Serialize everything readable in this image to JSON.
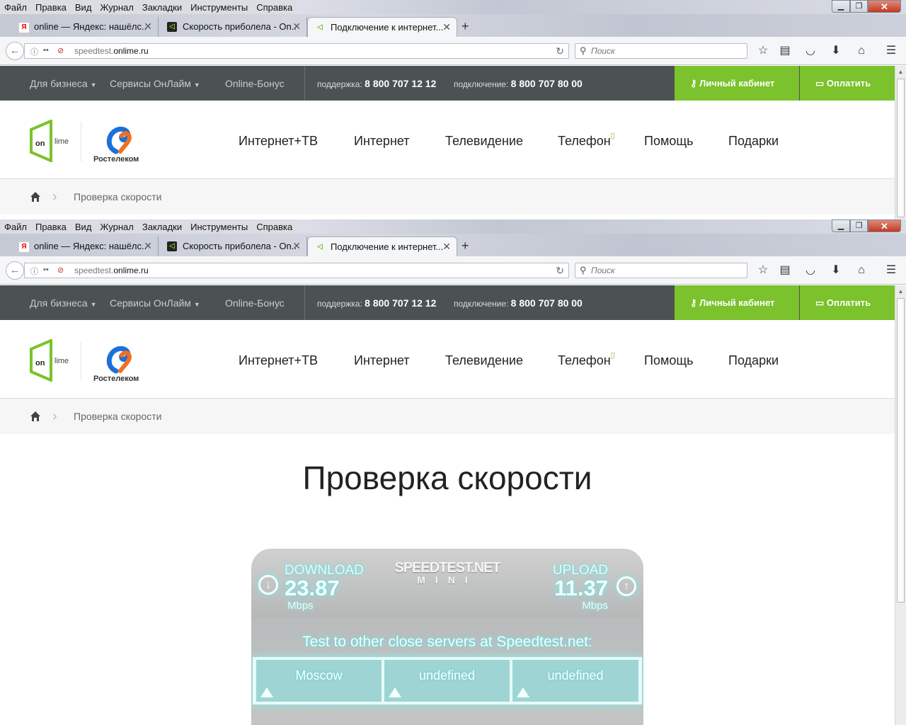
{
  "menu": [
    "Файл",
    "Правка",
    "Вид",
    "Журнал",
    "Закладки",
    "Инструменты",
    "Справка"
  ],
  "window_controls": {
    "min": "▁",
    "max": "❐",
    "close": "✕"
  },
  "tabs": [
    {
      "title": "online — Яндекс: нашёлс...",
      "favicon": "yandex-icon"
    },
    {
      "title": "Скорость приболела - On...",
      "favicon": "onlime-icon"
    },
    {
      "title": "Подключение к интернет...",
      "favicon": "onlime-icon"
    }
  ],
  "address": {
    "prefix": "speedtest.",
    "domain": "onlime.ru"
  },
  "search": {
    "placeholder": "Поиск"
  },
  "site": {
    "top_links": {
      "business": "Для бизнеса",
      "services": "Сервисы ОнЛайм",
      "bonus": "Online-Бонус"
    },
    "support_label": "поддержка:",
    "support_phone": "8 800 707 12 12",
    "connect_label": "подключение:",
    "connect_phone": "8 800 707 80 00",
    "cabinet": "Личный кабинет",
    "pay": "Оплатить",
    "logo_online": {
      "on": "on",
      "lime": "lime"
    },
    "logo_rt": "Ростелеком",
    "nav": [
      "Интернет+ТВ",
      "Интернет",
      "Телевидение",
      "Телефон",
      "Помощь",
      "Подарки"
    ],
    "breadcrumb": "Проверка скорости",
    "page_title": "Проверка скорости"
  },
  "speedtest": {
    "brand": "SPEEDTEST.NET",
    "mini": "MINI",
    "download_label": "DOWNLOAD",
    "download_value": "23.87",
    "download_unit": "Mbps",
    "upload_label": "UPLOAD",
    "upload_value": "11.37",
    "upload_unit": "Mbps",
    "other_servers": "Test to other close servers at Speedtest.net:",
    "servers": [
      "Moscow",
      "undefined",
      "undefined"
    ]
  },
  "colors": {
    "accent_green": "#7bc22c",
    "topbar": "#4c5252",
    "glow": "#7eeeee"
  }
}
